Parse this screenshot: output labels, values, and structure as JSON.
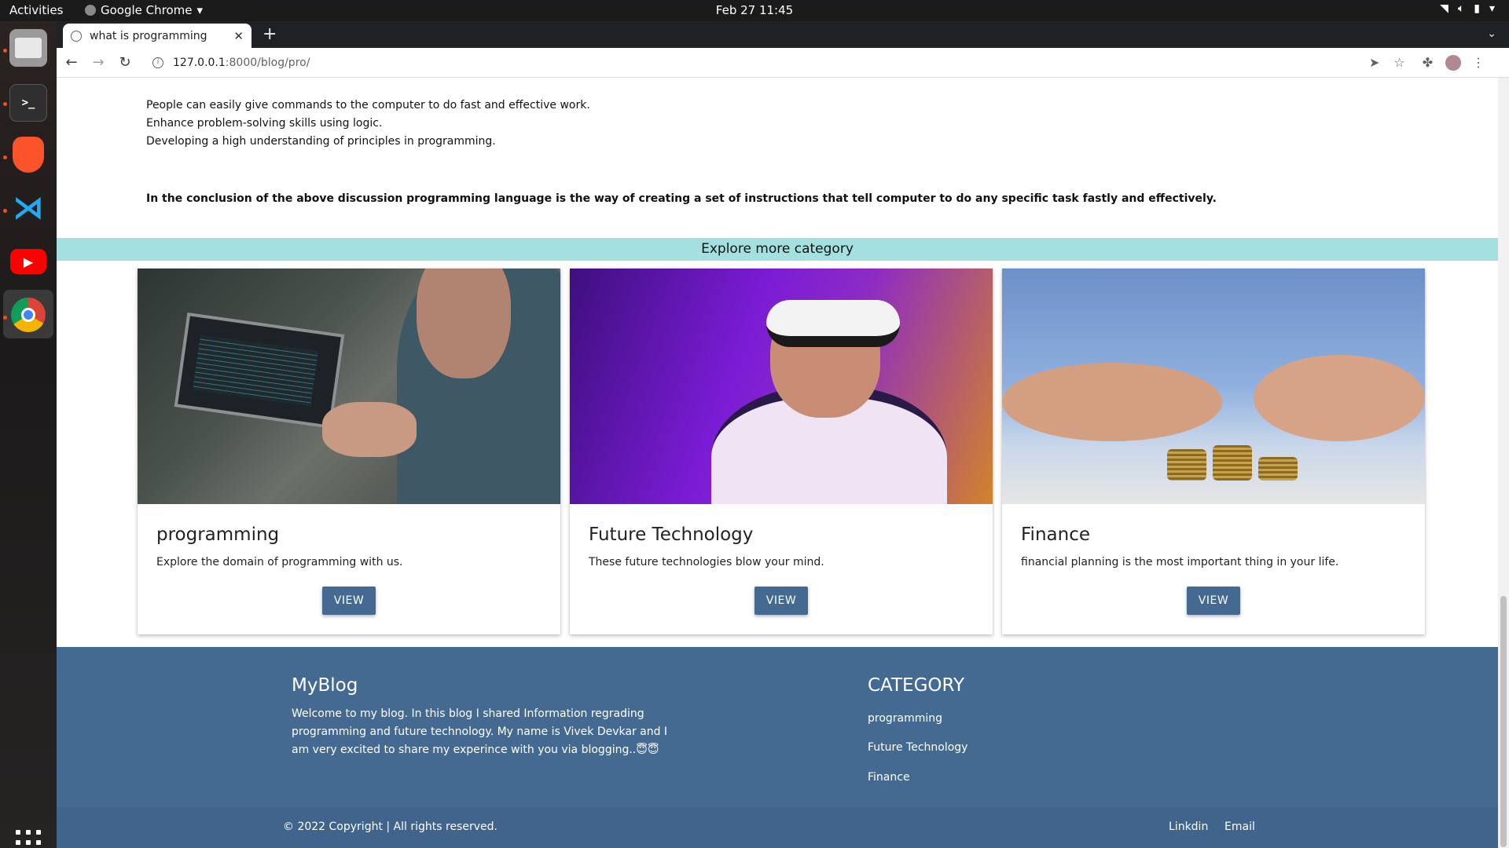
{
  "os": {
    "activities": "Activities",
    "app_name": "Google Chrome",
    "datetime": "Feb 27  11:45"
  },
  "browser": {
    "tab_title": "what is programming",
    "url_host": "127.0.0.1",
    "url_path": ":8000/blog/pro/"
  },
  "article": {
    "points": [
      "People can easily give commands to the computer to do fast and effective work.",
      "Enhance problem-solving skills using logic.",
      "Developing a high understanding of principles in programming."
    ],
    "conclusion": "In the conclusion of the above discussion programming language is the way of creating a set of instructions that tell computer to do any specific task fastly and effectively."
  },
  "explore": {
    "heading": "Explore more category",
    "cards": [
      {
        "title": "programming",
        "desc": "Explore the domain of programming with us.",
        "button": "VIEW"
      },
      {
        "title": "Future Technology",
        "desc": "These future technologies blow your mind.",
        "button": "VIEW"
      },
      {
        "title": "Finance",
        "desc": "financial planning is the most important thing in your life.",
        "button": "VIEW"
      }
    ]
  },
  "footer": {
    "brand": "MyBlog",
    "about": "Welcome to my blog. In this blog I shared Information regrading programming and future technology. My name is Vivek Devkar and I am very excited to share my experince with you via blogging..😇😇",
    "category_title": "CATEGORY",
    "categories": [
      "programming",
      "Future Technology",
      "Finance"
    ],
    "copyright": "© 2022 Copyright | All rights reserved.",
    "links": [
      "Linkdin",
      "Email"
    ]
  }
}
